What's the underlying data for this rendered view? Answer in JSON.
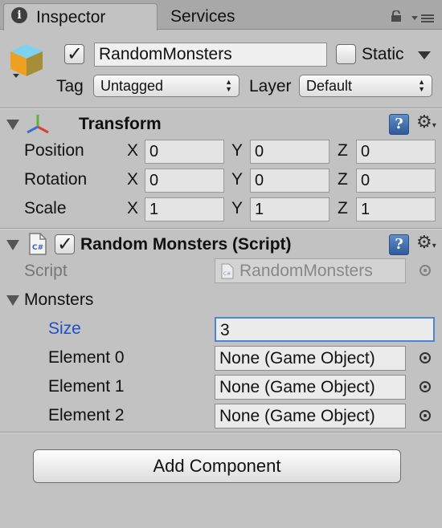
{
  "tabs": {
    "inspector": "Inspector",
    "services": "Services"
  },
  "header": {
    "name": "RandomMonsters",
    "static_label": "Static",
    "tag_label": "Tag",
    "tag_value": "Untagged",
    "layer_label": "Layer",
    "layer_value": "Default"
  },
  "transform": {
    "title": "Transform",
    "rows": [
      {
        "label": "Position",
        "x": "0",
        "y": "0",
        "z": "0"
      },
      {
        "label": "Rotation",
        "x": "0",
        "y": "0",
        "z": "0"
      },
      {
        "label": "Scale",
        "x": "1",
        "y": "1",
        "z": "1"
      }
    ],
    "axes": [
      "X",
      "Y",
      "Z"
    ]
  },
  "script_comp": {
    "title": "Random Monsters (Script)",
    "script_label": "Script",
    "script_value": "RandomMonsters",
    "cs_badge": "C#",
    "monsters_label": "Monsters",
    "size_label": "Size",
    "size_value": "3",
    "elements": [
      {
        "label": "Element 0",
        "value": "None (Game Object)"
      },
      {
        "label": "Element 1",
        "value": "None (Game Object)"
      },
      {
        "label": "Element 2",
        "value": "None (Game Object)"
      }
    ]
  },
  "add_component_label": "Add Component",
  "icons": {
    "info": "info-icon",
    "lock": "lock-icon",
    "menu": "menu-icon",
    "gameobject": "cube-icon",
    "transform": "transform-gizmo-icon",
    "help": "help-book-icon",
    "settings": "gear-icon",
    "script": "csharp-file-icon",
    "picker": "object-picker-icon"
  },
  "colors": {
    "panel_bg": "#c2c2c2",
    "tab_bar": "#a8a8a8",
    "size_label": "#1f4fc8",
    "focus_border": "#4c84d8"
  }
}
